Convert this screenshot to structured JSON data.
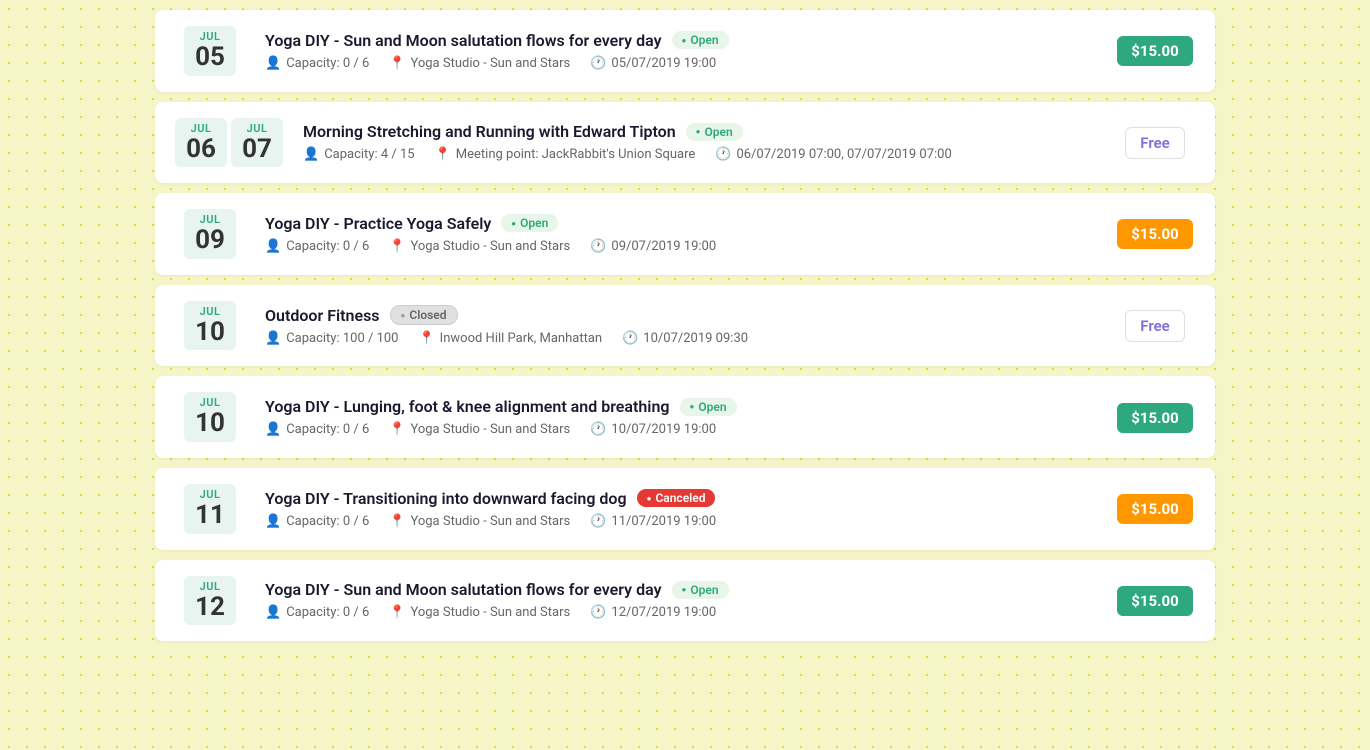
{
  "events": [
    {
      "id": "event-1",
      "months": [
        "JUL"
      ],
      "days": [
        "05"
      ],
      "title": "Yoga DIY - Sun and Moon salutation flows for every day",
      "status": "Open",
      "status_type": "open",
      "capacity": "0 / 6",
      "location": "Yoga Studio - Sun and Stars",
      "datetime": "05/07/2019 19:00",
      "price": "$15.00",
      "price_type": "green"
    },
    {
      "id": "event-2",
      "months": [
        "JUL",
        "JUL"
      ],
      "days": [
        "06",
        "07"
      ],
      "title": "Morning Stretching and Running with Edward Tipton",
      "status": "Open",
      "status_type": "open",
      "capacity": "4 / 15",
      "location": "Meeting point: JackRabbit's Union Square",
      "datetime": "06/07/2019 07:00, 07/07/2019 07:00",
      "price": "Free",
      "price_type": "free"
    },
    {
      "id": "event-3",
      "months": [
        "JUL"
      ],
      "days": [
        "09"
      ],
      "title": "Yoga DIY - Practice Yoga Safely",
      "status": "Open",
      "status_type": "open",
      "capacity": "0 / 6",
      "location": "Yoga Studio - Sun and Stars",
      "datetime": "09/07/2019 19:00",
      "price": "$15.00",
      "price_type": "orange"
    },
    {
      "id": "event-4",
      "months": [
        "JUL"
      ],
      "days": [
        "10"
      ],
      "title": "Outdoor Fitness",
      "status": "Closed",
      "status_type": "closed",
      "capacity": "100 / 100",
      "location": "Inwood Hill Park, Manhattan",
      "datetime": "10/07/2019 09:30",
      "price": "Free",
      "price_type": "free"
    },
    {
      "id": "event-5",
      "months": [
        "JUL"
      ],
      "days": [
        "10"
      ],
      "title": "Yoga DIY - Lunging, foot & knee alignment and breathing",
      "status": "Open",
      "status_type": "open",
      "capacity": "0 / 6",
      "location": "Yoga Studio - Sun and Stars",
      "datetime": "10/07/2019 19:00",
      "price": "$15.00",
      "price_type": "green"
    },
    {
      "id": "event-6",
      "months": [
        "JUL"
      ],
      "days": [
        "11"
      ],
      "title": "Yoga DIY - Transitioning into downward facing dog",
      "status": "Canceled",
      "status_type": "canceled",
      "capacity": "0 / 6",
      "location": "Yoga Studio - Sun and Stars",
      "datetime": "11/07/2019 19:00",
      "price": "$15.00",
      "price_type": "orange"
    },
    {
      "id": "event-7",
      "months": [
        "JUL"
      ],
      "days": [
        "12"
      ],
      "title": "Yoga DIY - Sun and Moon salutation flows for every day",
      "status": "Open",
      "status_type": "open",
      "capacity": "0 / 6",
      "location": "Yoga Studio - Sun and Stars",
      "datetime": "12/07/2019 19:00",
      "price": "$15.00",
      "price_type": "green"
    }
  ],
  "icons": {
    "person": "👤",
    "location": "📍",
    "clock": "🕐"
  }
}
